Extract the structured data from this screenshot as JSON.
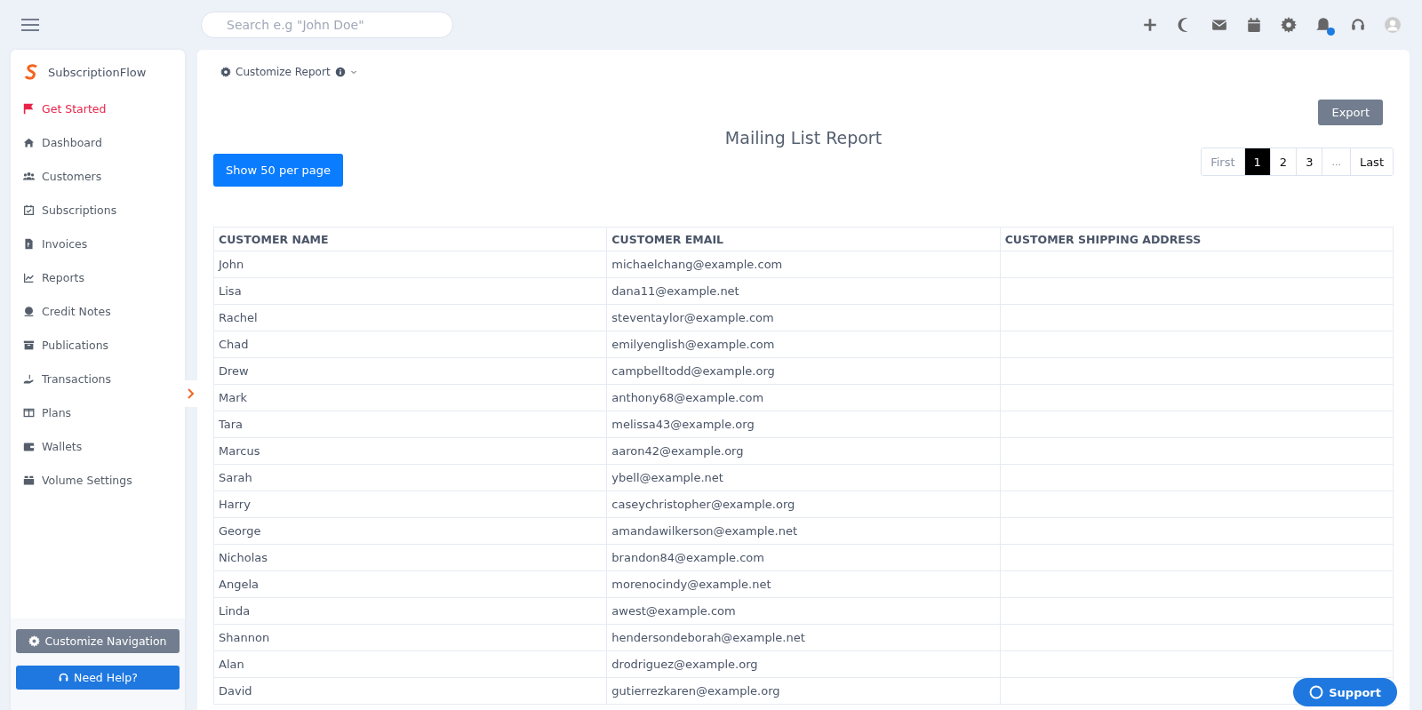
{
  "topbar": {
    "search": {
      "placeholder": "Search e.g \"John Doe\""
    },
    "notification_dot": {
      "color": "#1e7be0"
    }
  },
  "sidebar": {
    "brand": "SubscriptionFlow",
    "items": [
      {
        "label": "Get Started",
        "selected": true
      },
      {
        "label": "Dashboard",
        "selected": false
      },
      {
        "label": "Customers",
        "selected": false
      },
      {
        "label": "Subscriptions",
        "selected": false
      },
      {
        "label": "Invoices",
        "selected": false
      },
      {
        "label": "Reports",
        "selected": false
      },
      {
        "label": "Credit Notes",
        "selected": false
      },
      {
        "label": "Publications",
        "selected": false
      },
      {
        "label": "Transactions",
        "selected": false
      },
      {
        "label": "Plans",
        "selected": false
      },
      {
        "label": "Wallets",
        "selected": false
      },
      {
        "label": "Volume Settings",
        "selected": false
      }
    ],
    "customize_button": "Customize Navigation",
    "help_button": "Need Help?"
  },
  "main": {
    "customize_report": "Customize Report",
    "export_button": "Export",
    "title": "Mailing List Report",
    "per_page_button": "Show 50 per page",
    "pagination": [
      {
        "label": "First",
        "kind": "nav",
        "selected": false
      },
      {
        "label": "1",
        "kind": "page",
        "selected": true
      },
      {
        "label": "2",
        "kind": "page",
        "selected": false
      },
      {
        "label": "3",
        "kind": "page",
        "selected": false
      },
      {
        "label": "...",
        "kind": "gap",
        "selected": false
      },
      {
        "label": "Last",
        "kind": "nav",
        "selected": false
      }
    ],
    "table": {
      "columns": [
        "CUSTOMER NAME",
        "CUSTOMER EMAIL",
        "CUSTOMER SHIPPING ADDRESS"
      ],
      "rows": [
        [
          "John",
          "michaelchang@example.com"
        ],
        [
          "Lisa",
          "dana11@example.net"
        ],
        [
          "Rachel",
          "steventaylor@example.com"
        ],
        [
          "Chad",
          "emilyenglish@example.com"
        ],
        [
          "Drew",
          "campbelltodd@example.org"
        ],
        [
          "Mark",
          "anthony68@example.com"
        ],
        [
          "Tara",
          "melissa43@example.org"
        ],
        [
          "Marcus",
          "aaron42@example.org"
        ],
        [
          "Sarah",
          "ybell@example.net"
        ],
        [
          "Harry",
          "caseychristopher@example.org"
        ],
        [
          "George",
          "amandawilkerson@example.net"
        ],
        [
          "Nicholas",
          "brandon84@example.com"
        ],
        [
          "Angela",
          "morenocindy@example.net"
        ],
        [
          "Linda",
          "awest@example.com"
        ],
        [
          "Shannon",
          "hendersondeborah@example.net"
        ],
        [
          "Alan",
          "drodriguez@example.org"
        ],
        [
          "David",
          "gutierrezkaren@example.org"
        ]
      ]
    }
  },
  "support_button": "Support"
}
